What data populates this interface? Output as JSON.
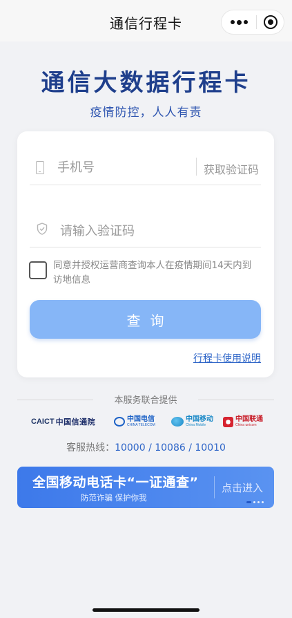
{
  "nav": {
    "title": "通信行程卡"
  },
  "header": {
    "title": "通信大数据行程卡",
    "subtitle": "疫情防控，人人有责"
  },
  "form": {
    "phone_placeholder": "手机号",
    "get_code_label": "获取验证码",
    "code_placeholder": "请输入验证码",
    "agree_text": "同意并授权运营商查询本人在疫情期间14天内到访地信息",
    "agree_checked": false,
    "query_button": "查询",
    "guide_link": "行程卡使用说明"
  },
  "providers": {
    "heading": "本服务联合提供",
    "items": [
      {
        "name": "CAICT中国信通院",
        "abbr": "CAICT",
        "zh": "中国信通院"
      },
      {
        "name": "中国电信",
        "zh": "中国电信",
        "en": "CHINA TELECOM"
      },
      {
        "name": "中国移动",
        "zh": "中国移动",
        "en": "China Mobile"
      },
      {
        "name": "中国联通",
        "zh": "中国联通",
        "en": "China unicom"
      }
    ],
    "hotline_label": "客服热线：",
    "hotline_numbers": "10000 / 10086 / 10010"
  },
  "banner": {
    "title": "全国移动电话卡“一证通查”",
    "subtitle": "防范诈骗 保护你我",
    "action": "点击进入",
    "bg_color": "#4a86ee"
  },
  "colors": {
    "title_blue": "#1f3f8c",
    "link_blue": "#2f66c8",
    "button_blue": "#86b6f7"
  },
  "icons": {
    "phone": "phone-icon",
    "verify": "shield-icon",
    "more": "more-dots-icon",
    "close": "miniapp-close-icon"
  }
}
